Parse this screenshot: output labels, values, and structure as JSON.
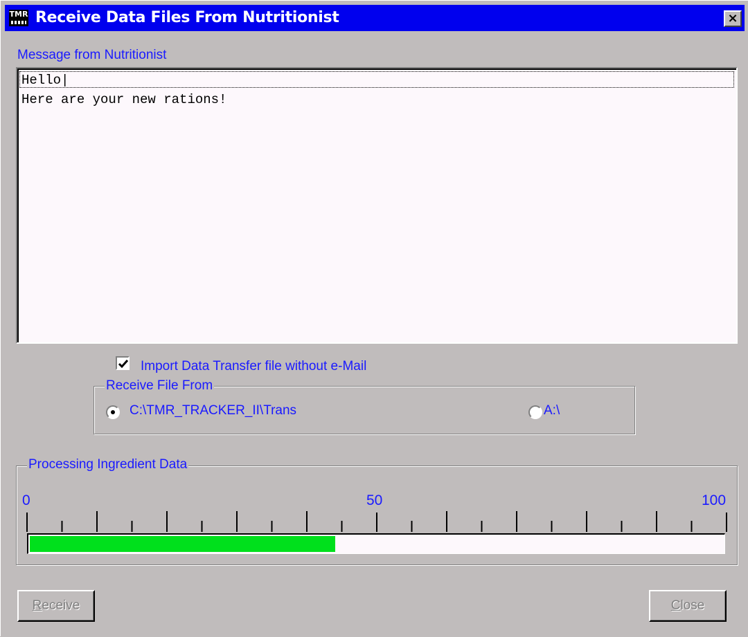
{
  "window": {
    "title": "Receive Data Files From Nutritionist",
    "icon_text": "TMR",
    "close_glyph": "×"
  },
  "message": {
    "label": "Message from Nutritionist",
    "lines": [
      "Hello|",
      "Here are your new rations!"
    ]
  },
  "import_option": {
    "label": "Import Data Transfer file without e-Mail",
    "checked": true
  },
  "receive_from": {
    "title": "Receive File From",
    "options": [
      {
        "label": "C:\\TMR_TRACKER_II\\Trans",
        "selected": true
      },
      {
        "label": "A:\\",
        "selected": false
      }
    ]
  },
  "processing": {
    "title": "Processing Ingredient Data",
    "scale_labels": [
      "0",
      "50",
      "100"
    ],
    "progress_percent": 44,
    "fill_color": "#00e01c"
  },
  "buttons": {
    "receive_first": "R",
    "receive_rest": "eceive",
    "close_first": "C",
    "close_rest": "lose"
  },
  "colors": {
    "titlebar": "#0000ee",
    "label_blue": "#1a1aff",
    "face": "#c0bcbc"
  }
}
